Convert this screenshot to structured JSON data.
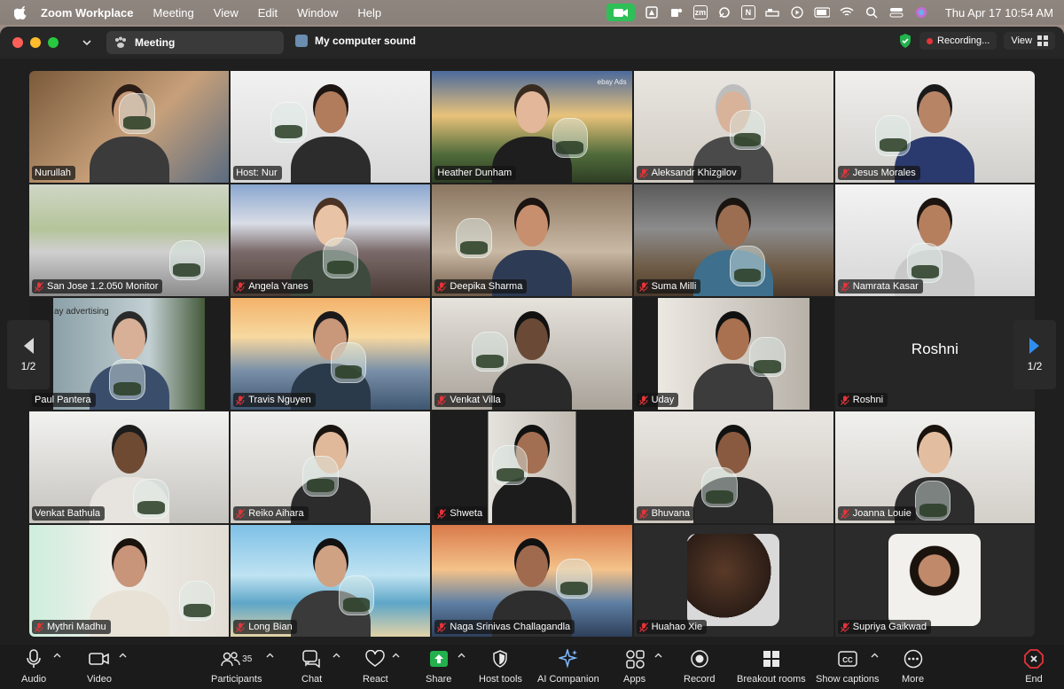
{
  "menubar": {
    "app_name": "Zoom Workplace",
    "items": [
      "Meeting",
      "View",
      "Edit",
      "Window",
      "Help"
    ],
    "zoom_badge": "zm",
    "n_badge": "N",
    "clock": "Thu Apr 17  10:54 AM"
  },
  "titlebar": {
    "tab_label": "Meeting",
    "sound_label": "My computer sound",
    "recording_label": "Recording...",
    "view_label": "View"
  },
  "pager": {
    "page_label": "1/2"
  },
  "participants": [
    {
      "name": "Nurullah",
      "muted": false
    },
    {
      "name": "Host: Nur",
      "muted": false,
      "active": true
    },
    {
      "name": "Heather Dunham",
      "muted": false
    },
    {
      "name": "Aleksandr Khizgilov",
      "muted": true
    },
    {
      "name": "Jesus Morales",
      "muted": true
    },
    {
      "name": "San Jose 1.2.050 Monitor",
      "muted": true
    },
    {
      "name": "Angela Yanes",
      "muted": true
    },
    {
      "name": "Deepika Sharma",
      "muted": true
    },
    {
      "name": "Suma Milli",
      "muted": true
    },
    {
      "name": "Namrata Kasar",
      "muted": true
    },
    {
      "name": "Paul Pantera",
      "muted": false
    },
    {
      "name": "Travis Nguyen",
      "muted": true
    },
    {
      "name": "Venkat Villa",
      "muted": true
    },
    {
      "name": "Uday",
      "muted": true
    },
    {
      "name": "Roshni",
      "muted": true,
      "video_off": true
    },
    {
      "name": "Venkat Bathula",
      "muted": false
    },
    {
      "name": "Reiko Aihara",
      "muted": true
    },
    {
      "name": "Shweta",
      "muted": true
    },
    {
      "name": "Bhuvana",
      "muted": true
    },
    {
      "name": "Joanna Louie",
      "muted": true
    },
    {
      "name": "Mythri Madhu",
      "muted": true
    },
    {
      "name": "Long Bian",
      "muted": true
    },
    {
      "name": "Naga Srinivas Challagandla",
      "muted": true
    },
    {
      "name": "Huahao Xie",
      "muted": true,
      "avatar": true
    },
    {
      "name": "Supriya Gaikwad",
      "muted": true,
      "avatar": true
    }
  ],
  "tile_text": {
    "ebay_ads": "ebay Ads",
    "ebay_advertising": "ay advertising"
  },
  "toolbar": {
    "audio": "Audio",
    "video": "Video",
    "participants": "Participants",
    "participant_count": "35",
    "chat": "Chat",
    "react": "React",
    "share": "Share",
    "host_tools": "Host tools",
    "ai_companion": "AI Companion",
    "apps": "Apps",
    "record": "Record",
    "breakout_rooms": "Breakout rooms",
    "show_captions": "Show captions",
    "more": "More",
    "end": "End"
  },
  "colors": {
    "active_speaker": "#23b14d",
    "recording": "#e5343a",
    "mute": "#e5343a",
    "share": "#23b14d"
  }
}
